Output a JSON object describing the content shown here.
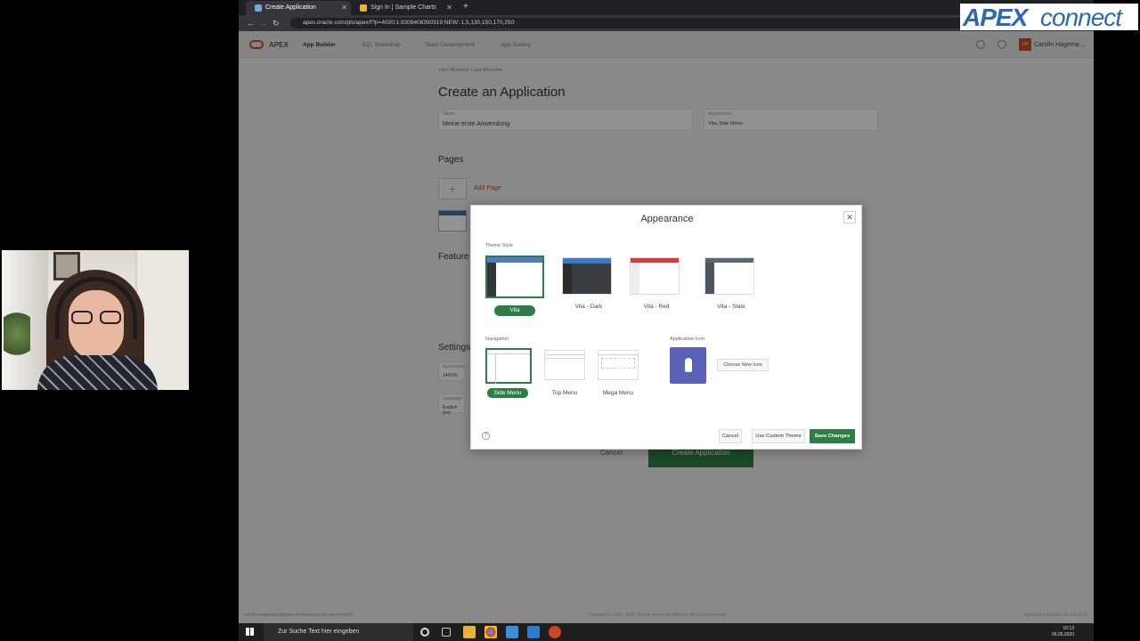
{
  "browser": {
    "tabs": [
      {
        "label": "Create Application",
        "active": true
      },
      {
        "label": "Sign In | Sample Charts",
        "active": false
      }
    ],
    "url": "apex.oracle.com/pls/apex/f?p=4020:1:9309408390319:NEW::1,5,130,150,170,250:"
  },
  "apex": {
    "product": "APEX",
    "menu": [
      "App Builder",
      "SQL Workshop",
      "Team Development",
      "App Gallery"
    ],
    "user_initials": "CH",
    "user_name": "Carolin Hagema..."
  },
  "page": {
    "breadcrumbs": "View Blueprint    Load Blueprint",
    "title": "Create an Application",
    "name_label": "Name",
    "name_value": "Meine erste Anwendung",
    "appearance_label": "Appearance",
    "appearance_value": "Vita, Side Menu",
    "pages_heading": "Pages",
    "add_page": "Add Page",
    "features_heading": "Feature",
    "settings_heading": "Settings",
    "app_id_label": "Application",
    "app_id_value": "144165",
    "language_label": "Language",
    "language_value": "English (en)",
    "cancel": "Cancel",
    "create": "Create Application",
    "footer_left": "carolin.hagemann@apex-in-hamburg.com    apexconn20",
    "footer_center": "Copyright © 1999, 2020, Oracle and/or its affiliates. All rights reserved.",
    "footer_right": "Application Express 20.1.0.00.13"
  },
  "modal": {
    "title": "Appearance",
    "theme_style_label": "Theme Style",
    "themes": [
      {
        "label": "Vita",
        "selected": true
      },
      {
        "label": "Vita - Dark",
        "selected": false
      },
      {
        "label": "Vita - Red",
        "selected": false
      },
      {
        "label": "Vita - Slate",
        "selected": false
      }
    ],
    "navigation_label": "Navigation",
    "navigation": [
      {
        "label": "Side Menu",
        "selected": true
      },
      {
        "label": "Top Menu",
        "selected": false
      },
      {
        "label": "Mega Menu",
        "selected": false
      }
    ],
    "app_icon_label": "Application Icon",
    "choose_icon": "Choose New Icon",
    "buttons": {
      "cancel": "Cancel",
      "custom": "Use Custom Theme",
      "save": "Save Changes"
    },
    "colors": {
      "accent": "#2e7d46",
      "icon_bg": "#5b62b5"
    }
  },
  "branding": {
    "apex": "APEX",
    "connect": "connect"
  },
  "taskbar": {
    "search_placeholder": "Zur Suche Text hier eingeben",
    "time": "10:13",
    "date": "06.05.2020"
  }
}
